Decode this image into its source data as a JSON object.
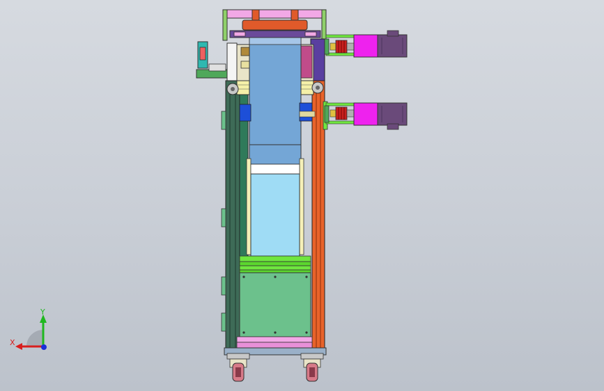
{
  "view": {
    "background_top": "#d6dae0",
    "background_bottom": "#bcc2cb"
  },
  "triad": {
    "x_label": "X",
    "y_label": "Y",
    "x_color": "#d81e1e",
    "y_color": "#1fb81f",
    "z_color": "#1a2fd8"
  },
  "colors": {
    "frame_dark_green": "#3e6b57",
    "frame_orange": "#e8632a",
    "carriage_blue": "#74a6d6",
    "carriage_light_blue": "#9fdcf5",
    "motor_magenta": "#ee22ee",
    "motor_purple": "#6a4a7a",
    "green_board": "#6cc18c",
    "lime": "#6fe63f",
    "pink": "#f2a8e6",
    "red_roller": "#e05a2a",
    "wheel": "#d77a88"
  }
}
